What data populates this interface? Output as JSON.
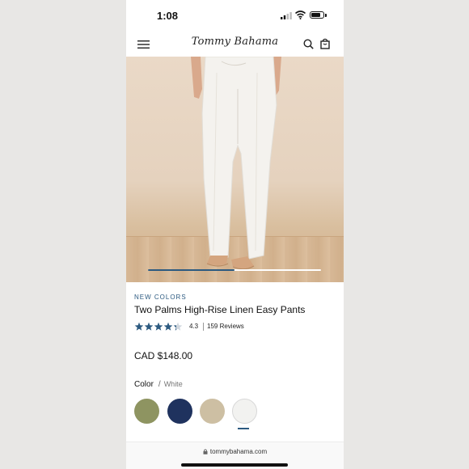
{
  "status_bar": {
    "time": "1:08",
    "battery_level": 0.85
  },
  "header": {
    "logo": "Tommy Bahama"
  },
  "gallery": {
    "progress": 0.5
  },
  "product": {
    "badge": "NEW COLORS",
    "name": "Two Palms High-Rise Linen Easy Pants",
    "rating": "4.3",
    "rating_value": 4.3,
    "reviews": "159 Reviews",
    "price": "CAD $148.00"
  },
  "color": {
    "label": "Color",
    "separator": "/",
    "selected": "White",
    "swatches": [
      {
        "color": "#8e9461",
        "selected": false
      },
      {
        "color": "#1f325e",
        "selected": false
      },
      {
        "color": "#cdbfa3",
        "selected": false
      },
      {
        "color": "#f2f2f0",
        "selected": true
      }
    ]
  },
  "browser": {
    "url": "tommybahama.com"
  },
  "colors": {
    "accent": "#2c5a80"
  }
}
